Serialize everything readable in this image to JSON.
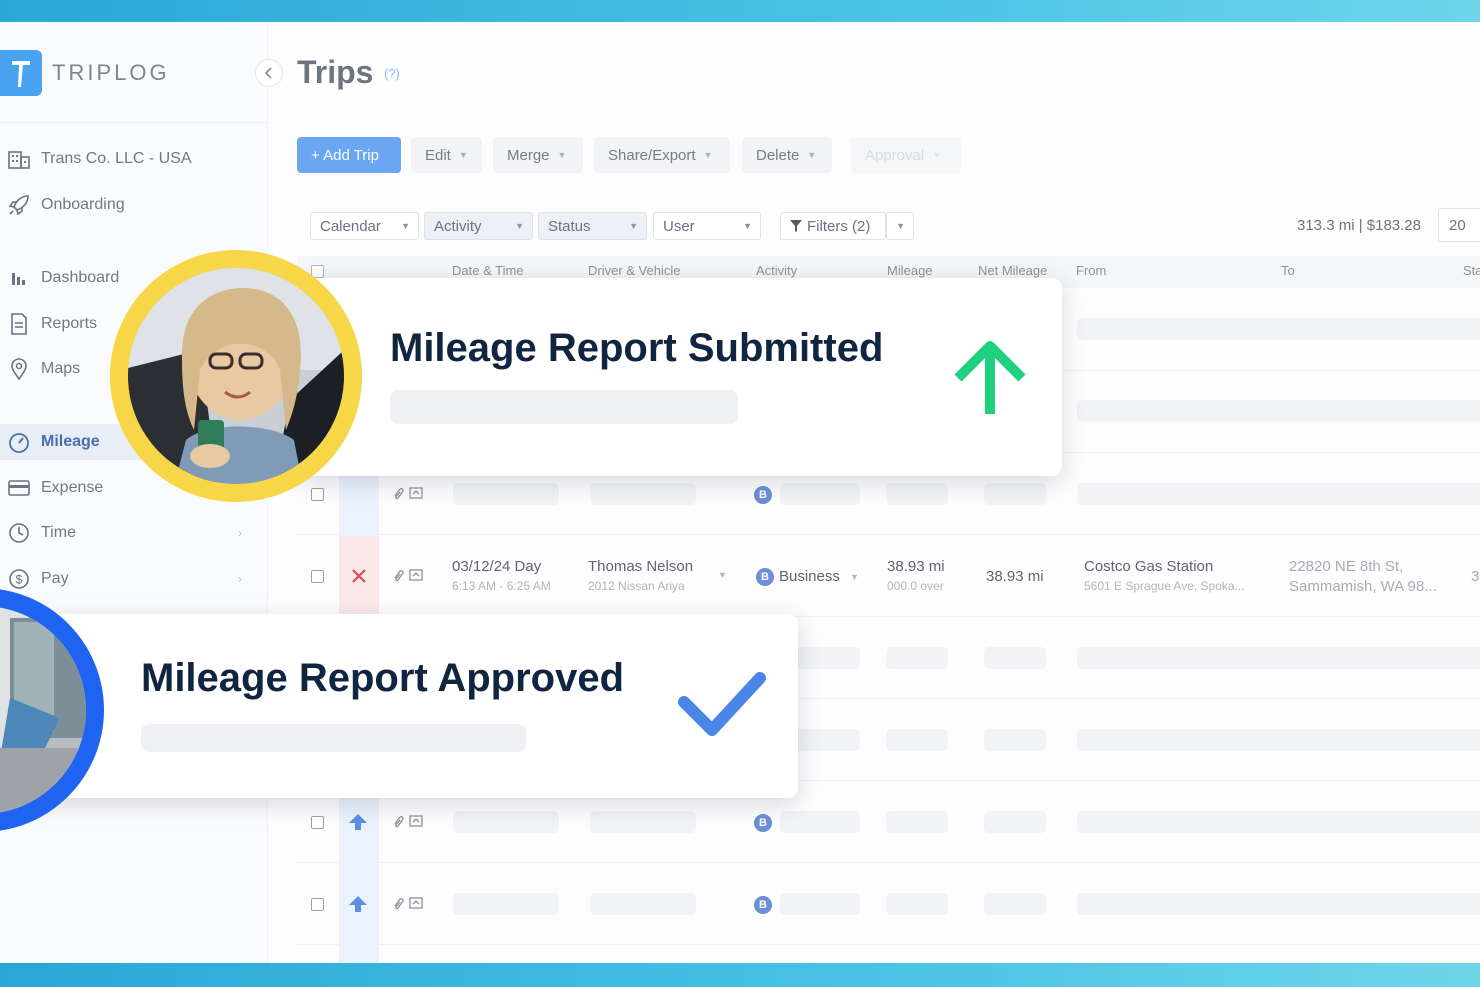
{
  "app": {
    "logo_text": "TRIPLOG",
    "logo_mark": "T"
  },
  "sidebar": {
    "items": [
      {
        "label": "Trans Co. LLC - USA",
        "icon": "building-icon"
      },
      {
        "label": "Onboarding",
        "icon": "rocket-icon"
      },
      {
        "label": "Dashboard",
        "icon": "bar-chart-icon"
      },
      {
        "label": "Reports",
        "icon": "document-icon"
      },
      {
        "label": "Maps",
        "icon": "map-pin-icon"
      },
      {
        "label": "Mileage",
        "icon": "speedometer-icon",
        "active": true
      },
      {
        "label": "Expense",
        "icon": "card-icon"
      },
      {
        "label": "Time",
        "icon": "clock-icon"
      },
      {
        "label": "Pay",
        "icon": "dollar-icon"
      }
    ]
  },
  "page": {
    "title": "Trips",
    "help": "(?)"
  },
  "toolbar": {
    "add_trip": "+ Add Trip",
    "edit": "Edit",
    "merge": "Merge",
    "share_export": "Share/Export",
    "delete": "Delete",
    "approval": "Approval"
  },
  "filters": {
    "calendar": "Calendar",
    "activity": "Activity",
    "status": "Status",
    "user": "User",
    "filters": "Filters (2)",
    "totals": "313.3 mi | $183.28",
    "per_page": "20"
  },
  "table": {
    "headers": {
      "date_time": "Date & Time",
      "driver_vehicle": "Driver & Vehicle",
      "activity": "Activity",
      "mileage": "Mileage",
      "net_mileage": "Net Mileage",
      "from": "From",
      "to": "To",
      "status": "Sta"
    },
    "trip": {
      "date": "03/12/24 Day",
      "time": "6:13 AM - 6:25 AM",
      "driver": "Thomas Nelson",
      "vehicle": "2012 Nissan Ariya",
      "activity_badge": "B",
      "activity": "Business",
      "mileage": "38.93 mi",
      "mileage_sub": "000.0 over",
      "net_mileage": "38.93 mi",
      "from": "Costco Gas Station",
      "from_sub": "5601 E Sprague Ave, Spoka...",
      "to": "22820 NE 8th St,",
      "to_sub": "Sammamish, WA 98...",
      "status_trunc": "3"
    },
    "row_badge": "B",
    "row_activity": "Business"
  },
  "notifications": {
    "submitted": "Mileage Report Submitted",
    "approved": "Mileage Report Approved"
  },
  "colors": {
    "accent": "#6aa6f2",
    "submitted_arrow": "#1fd17f",
    "approved_check": "#4a86e8",
    "avatar_ring_yellow": "#f7d747",
    "avatar_ring_blue": "#1e64f0",
    "strip": "#2aa7d6"
  }
}
